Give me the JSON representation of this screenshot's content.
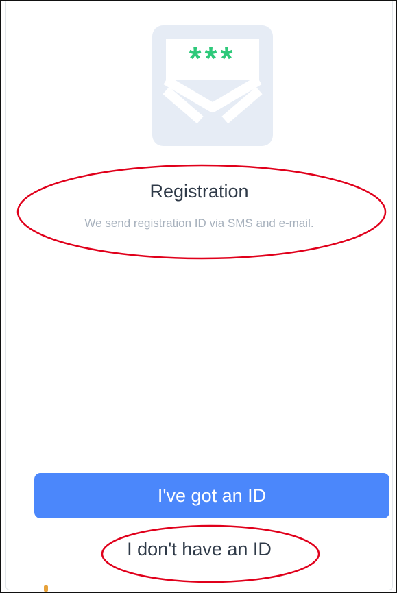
{
  "registration": {
    "title": "Registration",
    "subtitle": "We send registration ID via SMS and e-mail.",
    "icon": "envelope-with-password-icon",
    "password_mask": "***"
  },
  "actions": {
    "primary_label": "I've got an ID",
    "secondary_label": "I don't have an ID"
  },
  "colors": {
    "accent": "#4b87fb",
    "envelope": "#e6ecf5",
    "asterisks": "#2ec97a",
    "annotation": "#e0001b",
    "title_text": "#2f3a48",
    "subtitle_text": "#a7b1bd"
  }
}
